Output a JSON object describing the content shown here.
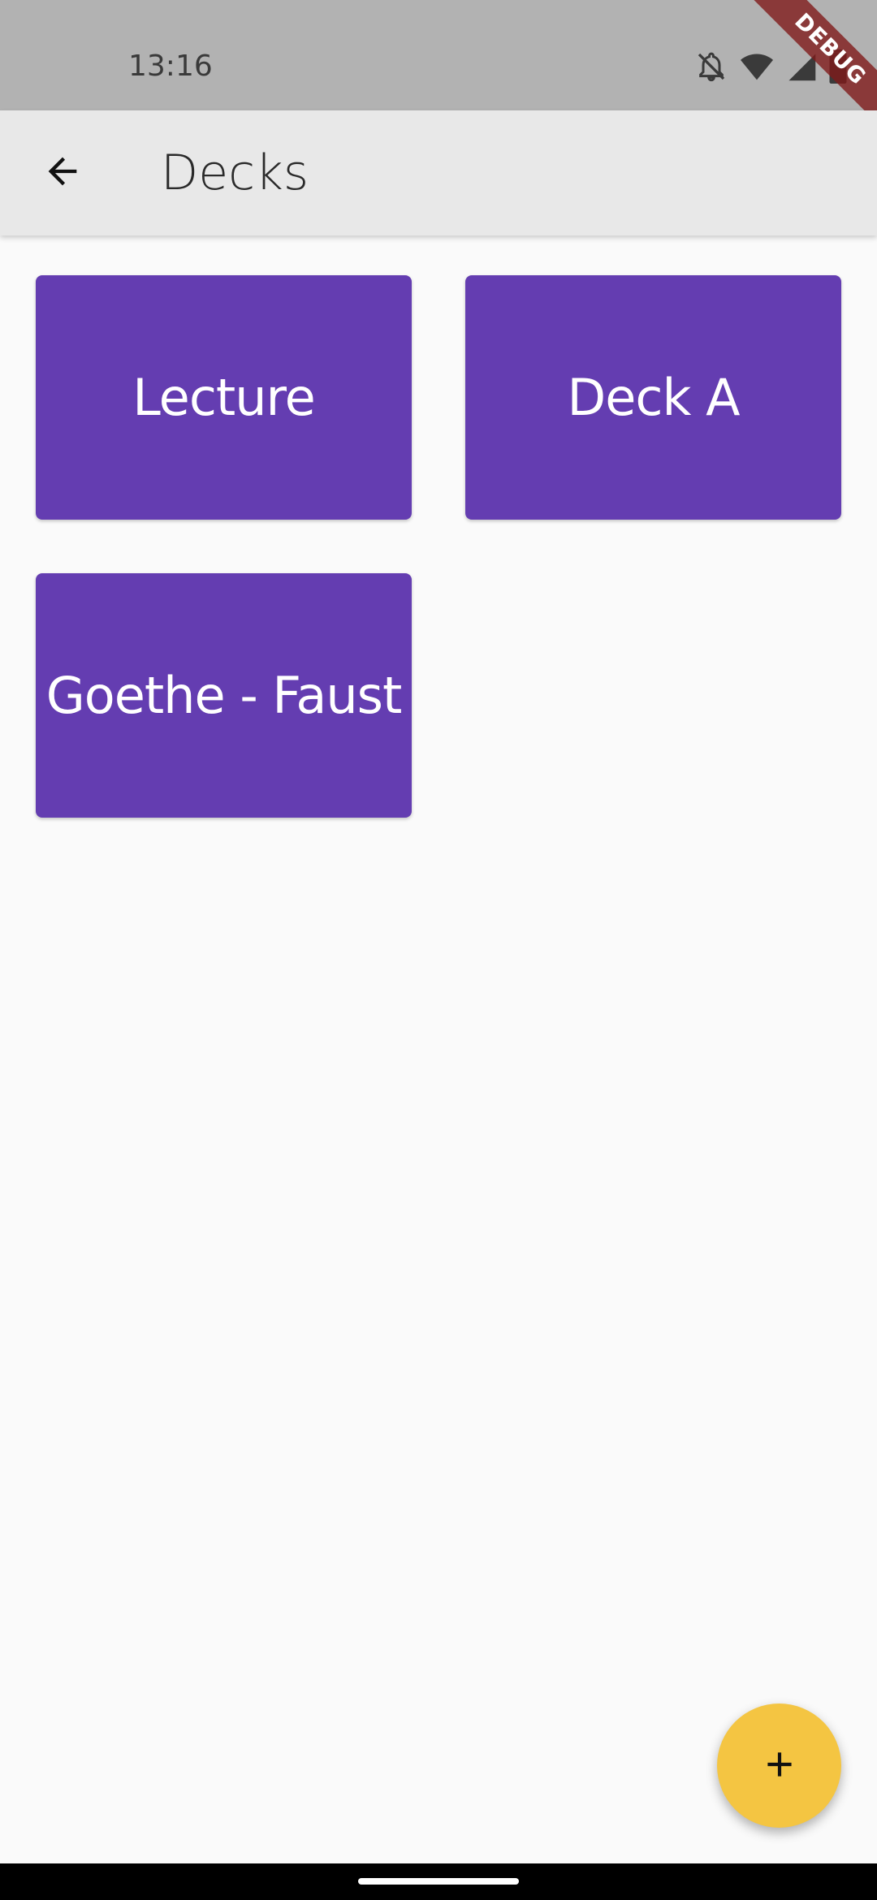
{
  "status_bar": {
    "time": "13:16",
    "icons": [
      "notifications-off-icon",
      "wifi-icon",
      "signal-icon",
      "battery-icon"
    ]
  },
  "debug_banner": {
    "label": "DEBUG"
  },
  "app_bar": {
    "back_icon": "arrow-back-icon",
    "title": "Decks"
  },
  "decks": [
    {
      "label": "Lecture"
    },
    {
      "label": "Deck A"
    },
    {
      "label": "Goethe - Faust"
    }
  ],
  "fab": {
    "icon": "plus-icon"
  },
  "colors": {
    "deck_card": "#643db1",
    "fab": "#f4c542",
    "app_bar": "#e8e8e8",
    "status_bar": "#b2b2b2",
    "background": "#fafafa"
  }
}
